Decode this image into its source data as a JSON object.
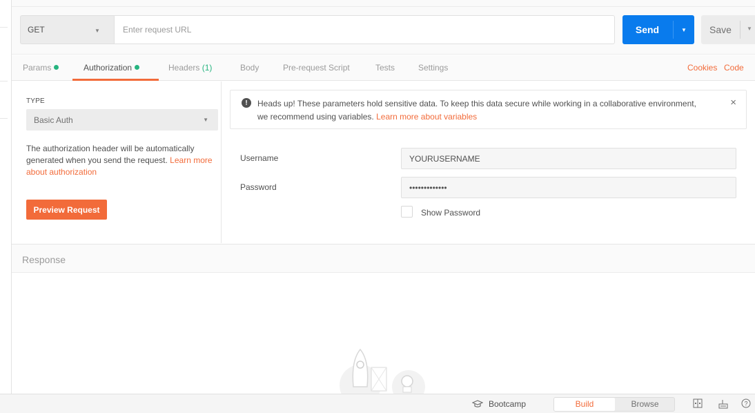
{
  "request": {
    "method": "GET",
    "url_value": "",
    "url_placeholder": "Enter request URL",
    "send_label": "Send",
    "save_label": "Save"
  },
  "tabs": [
    {
      "label": "Params",
      "has_dot": true
    },
    {
      "label": "Authorization",
      "has_dot": true,
      "active": true
    },
    {
      "label": "Headers",
      "count": "(1)"
    },
    {
      "label": "Body"
    },
    {
      "label": "Pre-request Script"
    },
    {
      "label": "Tests"
    },
    {
      "label": "Settings"
    }
  ],
  "tab_links": {
    "cookies": "Cookies",
    "code": "Code"
  },
  "auth": {
    "type_label": "TYPE",
    "type_value": "Basic Auth",
    "description": "The authorization header will be automatically generated when you send the request.",
    "learn_more": "Learn more about authorization",
    "preview_button": "Preview Request"
  },
  "alert": {
    "message": "Heads up! These parameters hold sensitive data. To keep this data secure while working in a collaborative environment, we recommend using variables.",
    "link": "Learn more about variables",
    "close": "×"
  },
  "fields": {
    "username_label": "Username",
    "username_value": "YOURUSERNAME",
    "password_label": "Password",
    "password_value": "•••••••••••••",
    "show_password_label": "Show Password",
    "show_password_checked": false
  },
  "response": {
    "title": "Response"
  },
  "status_bar": {
    "bootcamp": "Bootcamp",
    "build": "Build",
    "browse": "Browse"
  },
  "colors": {
    "accent": "#f26b3a",
    "send_blue": "#097bed",
    "dot_green": "#26b47f"
  }
}
